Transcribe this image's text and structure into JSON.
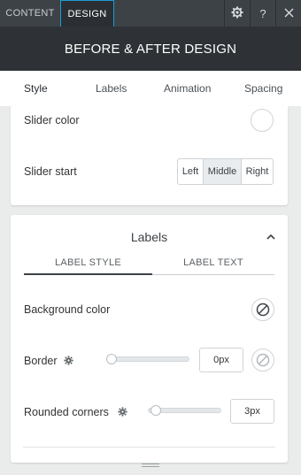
{
  "topbar": {
    "tabs": [
      {
        "label": "CONTENT"
      },
      {
        "label": "DESIGN"
      }
    ],
    "icons": [
      "gear-icon",
      "help-icon",
      "close-icon"
    ],
    "help_glyph": "?"
  },
  "header": {
    "title": "BEFORE & AFTER DESIGN"
  },
  "subtabs": [
    {
      "label": "Style"
    },
    {
      "label": "Labels"
    },
    {
      "label": "Animation"
    },
    {
      "label": "Spacing"
    }
  ],
  "style_section": {
    "slider_color_label": "Slider color",
    "slider_color_value": "#ffffff",
    "slider_start_label": "Slider start",
    "slider_start_options": [
      {
        "label": "Left"
      },
      {
        "label": "Middle"
      },
      {
        "label": "Right"
      }
    ],
    "slider_start_selected": "Middle"
  },
  "labels_section": {
    "title": "Labels",
    "inner_tabs": [
      {
        "label": "LABEL STYLE"
      },
      {
        "label": "LABEL TEXT"
      }
    ],
    "background_color_label": "Background color",
    "border_label": "Border",
    "border_value": "0px",
    "border_slider_fraction": 0,
    "rounded_corners_label": "Rounded corners",
    "rounded_corners_value": "3px",
    "rounded_corners_slider_fraction": 0.03
  },
  "colors": {
    "accent": "#1a9bd7",
    "topbar": "#3d4247",
    "header": "#2e3236",
    "inner_tab_active_line": "#3d4247"
  }
}
